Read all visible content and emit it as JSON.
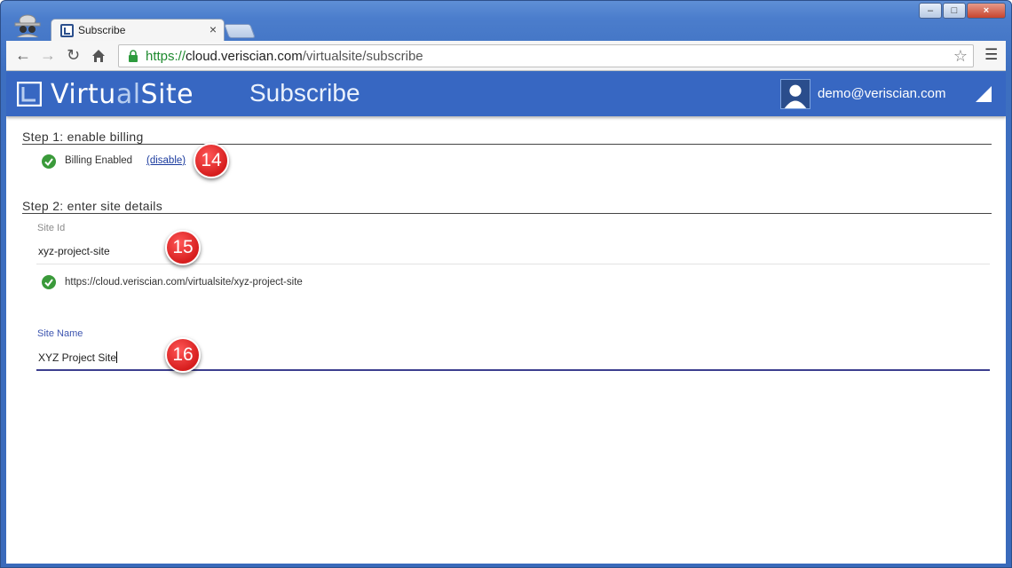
{
  "browser": {
    "tab_title": "Subscribe",
    "tab_close": "×",
    "url_scheme": "https://",
    "url_host": "cloud.veriscian.com",
    "url_path": "/virtualsite/subscribe",
    "icons": [
      "incognito-icon",
      "back-icon",
      "forward-icon",
      "reload-icon",
      "home-icon",
      "lock-icon",
      "star-icon",
      "menu-icon"
    ]
  },
  "app": {
    "logo_prefix": "Virtu",
    "logo_accent": "al",
    "logo_suffix": "Site",
    "page_title": "Subscribe",
    "user_email": "demo@veriscian.com",
    "accent_color": "#3767c2"
  },
  "step1": {
    "title": "Step 1: enable billing",
    "status": "Billing Enabled",
    "disable_link": "(disable)",
    "callout": "14"
  },
  "step2": {
    "title": "Step 2: enter site details",
    "site_id_label": "Site Id",
    "site_id_value": "xyz-project-site",
    "site_id_callout": "15",
    "site_url": "https://cloud.veriscian.com/virtualsite/xyz-project-site",
    "site_name_label": "Site Name",
    "site_name_value": "XYZ Project Site",
    "site_name_callout": "16"
  }
}
